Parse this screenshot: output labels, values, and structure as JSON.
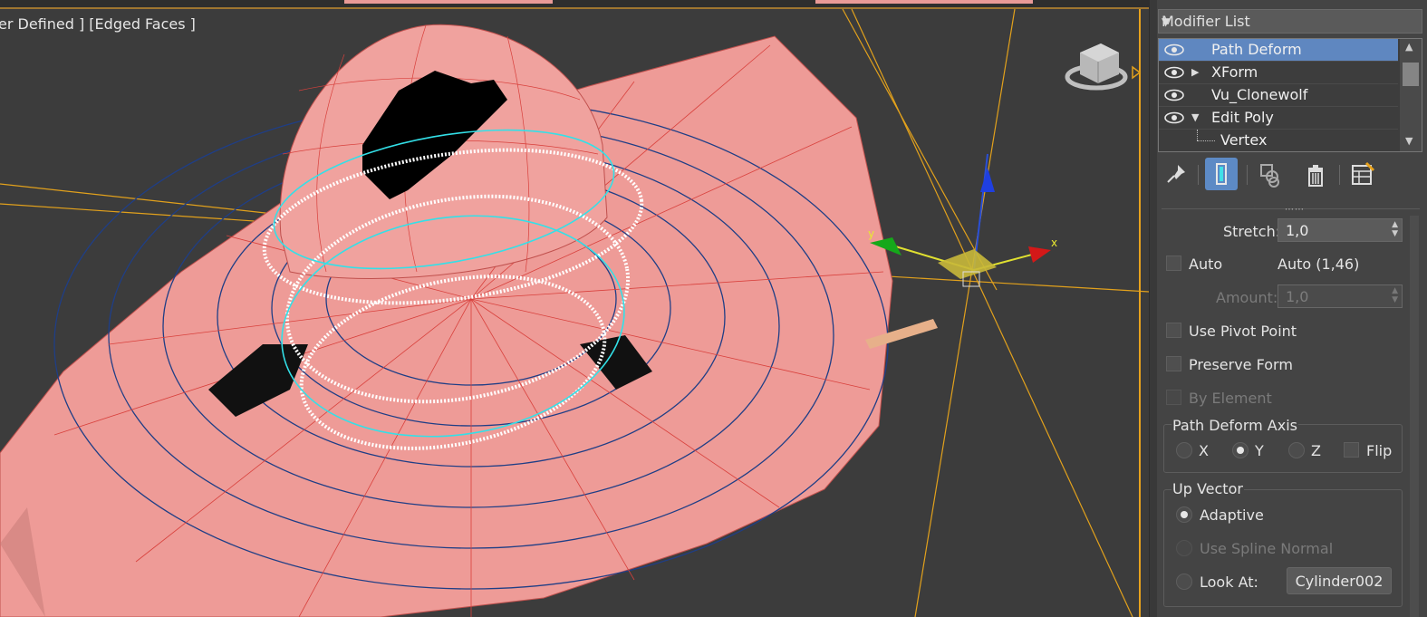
{
  "viewport": {
    "label": "er Defined ] [Edged Faces ]"
  },
  "modifier_list": {
    "label": "Modifier List"
  },
  "stack": {
    "items": [
      {
        "label": "Path Deform",
        "selected": true
      },
      {
        "label": "XForm",
        "expandable": true
      },
      {
        "label": "Vu_Clonewolf"
      },
      {
        "label": "Edit Poly",
        "expanded": true
      },
      {
        "label": "Vertex"
      }
    ]
  },
  "params": {
    "stretch_label": "Stretch:",
    "stretch_value": "1,0",
    "auto_label": "Auto",
    "auto_value": "Auto (1,46)",
    "amount_label": "Amount:",
    "amount_value": "1,0",
    "use_pivot_label": "Use Pivot Point",
    "preserve_form_label": "Preserve Form",
    "by_element_label": "By Element"
  },
  "axis_group": {
    "title": "Path Deform Axis",
    "x": "X",
    "y": "Y",
    "z": "Z",
    "flip": "Flip",
    "selected": "Y"
  },
  "up_vector_group": {
    "title": "Up Vector",
    "adaptive": "Adaptive",
    "use_spline_normal": "Use Spline Normal",
    "look_at": "Look At:",
    "look_at_target": "Cylinder002",
    "selected": "Adaptive"
  },
  "colors": {
    "mesh": "#ee9b97",
    "selection": "#5f87c0",
    "panel_bg": "#444444",
    "viewport_bg": "#3c3c3c"
  }
}
